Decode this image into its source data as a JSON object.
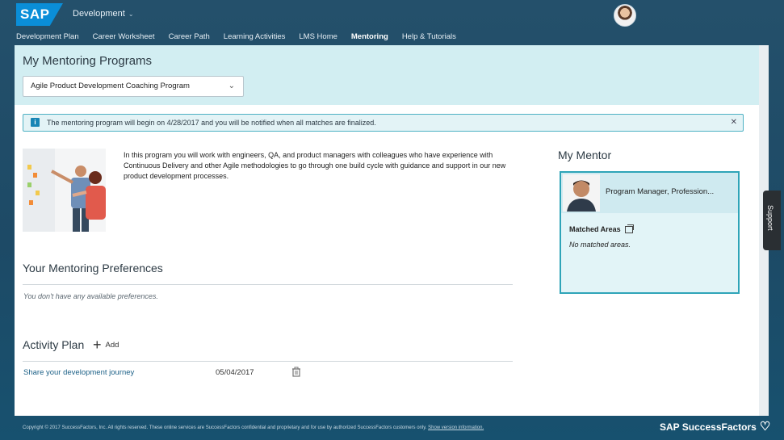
{
  "header": {
    "logo_text": "SAP",
    "module": "Development"
  },
  "nav": {
    "items": [
      {
        "label": "Development Plan"
      },
      {
        "label": "Career Worksheet"
      },
      {
        "label": "Career Path"
      },
      {
        "label": "Learning Activities"
      },
      {
        "label": "LMS Home"
      },
      {
        "label": "Mentoring",
        "active": true
      },
      {
        "label": "Help & Tutorials"
      }
    ]
  },
  "page": {
    "title": "My Mentoring Programs",
    "program_select": "Agile Product Development Coaching Program"
  },
  "banner": {
    "message": "The mentoring program will begin on 4/28/2017 and you will be notified when all matches are finalized."
  },
  "program": {
    "description": "In this program you will work with engineers, QA, and product managers with colleagues who have experience with Continuous Delivery and other Agile methodologies to go through one build cycle with guidance and support in our new product development processes."
  },
  "preferences": {
    "title": "Your Mentoring Preferences",
    "empty": "You don't have any available preferences."
  },
  "activity_plan": {
    "title": "Activity Plan",
    "add_label": "Add",
    "items": [
      {
        "name": "Share your development journey",
        "date": "05/04/2017"
      }
    ]
  },
  "mentor": {
    "title": "My Mentor",
    "role": "Program Manager, Profession...",
    "matched_areas_label": "Matched Areas",
    "matched_areas_empty": "No matched areas."
  },
  "support_tab": "Support",
  "footer": {
    "copyright": "Copyright © 2017 SuccessFactors, Inc. All rights reserved. These online services are SuccessFactors confidential and proprietary and for use by authorized SuccessFactors customers only.",
    "version_link": "Show version information.",
    "brand": "SAP SuccessFactors"
  },
  "colors": {
    "header_bg": "#1d4a66",
    "panel_head_bg": "#d2eef2",
    "accent": "#2fa4b8",
    "link": "#1a5f86"
  }
}
